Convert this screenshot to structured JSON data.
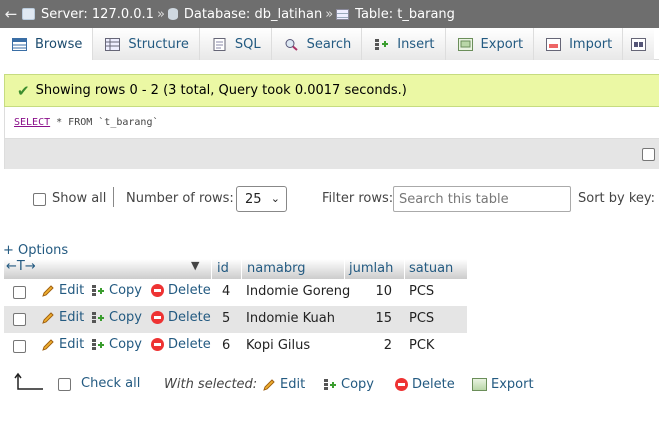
{
  "breadcrumb": {
    "server": "Server: 127.0.0.1",
    "database": "Database: db_latihan",
    "table": "Table: t_barang",
    "separator": "»"
  },
  "tabs": [
    {
      "label": "Browse",
      "icon": "browse-icon"
    },
    {
      "label": "Structure",
      "icon": "structure-icon"
    },
    {
      "label": "SQL",
      "icon": "sql-icon"
    },
    {
      "label": "Search",
      "icon": "search-icon"
    },
    {
      "label": "Insert",
      "icon": "insert-icon"
    },
    {
      "label": "Export",
      "icon": "export-icon"
    },
    {
      "label": "Import",
      "icon": "import-icon"
    }
  ],
  "message": "Showing rows 0 - 2 (3 total, Query took 0.0017 seconds.)",
  "query": {
    "select": "SELECT",
    "rest": " * FROM `t_barang`"
  },
  "navigation": {
    "show_all": "Show all",
    "rows_label": "Number of rows:",
    "rows_value": "25",
    "filter_label": "Filter rows:",
    "filter_placeholder": "Search this table",
    "sort_label": "Sort by key:"
  },
  "options_link": "+ Options",
  "table": {
    "columns": [
      "id",
      "namabrg",
      "jumlah",
      "satuan"
    ],
    "actions": {
      "edit": "Edit",
      "copy": "Copy",
      "delete": "Delete"
    },
    "rows": [
      {
        "id": "4",
        "namabrg": "Indomie Goreng",
        "jumlah": "10",
        "satuan": "PCS"
      },
      {
        "id": "5",
        "namabrg": "Indomie Kuah",
        "jumlah": "15",
        "satuan": "PCS"
      },
      {
        "id": "6",
        "namabrg": "Kopi Gilus",
        "jumlah": "2",
        "satuan": "PCK"
      }
    ]
  },
  "bulk": {
    "check_all": "Check all",
    "with_selected": "With selected:",
    "edit": "Edit",
    "copy": "Copy",
    "delete": "Delete",
    "export": "Export"
  },
  "colors": {
    "breadcrumb_bg": "#6e6e6e",
    "success_bg": "#ebf8a4",
    "link": "#235a81",
    "alt_row": "#e5e5e5"
  }
}
